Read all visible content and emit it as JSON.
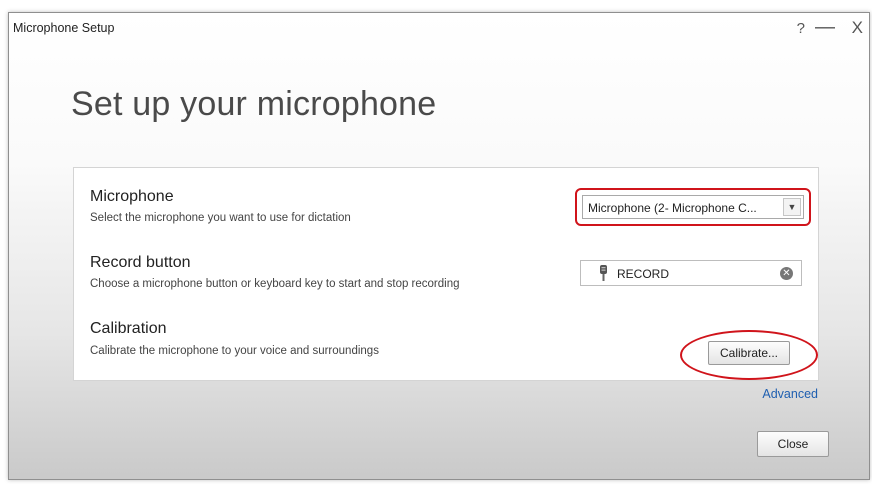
{
  "window": {
    "title": "Microphone Setup",
    "help": "?",
    "minimize": "—",
    "close": "X"
  },
  "heading": "Set up your microphone",
  "microphone": {
    "label": "Microphone",
    "description": "Select the microphone you want to use for dictation",
    "selected": "Microphone (2- Microphone C...",
    "arrow": "▼"
  },
  "record": {
    "label": "Record button",
    "description": "Choose a microphone button or keyboard key to start and stop recording",
    "key": "RECORD",
    "clear": "✕"
  },
  "calibration": {
    "label": "Calibration",
    "description": "Calibrate the microphone to your voice and surroundings",
    "button": "Calibrate..."
  },
  "advanced": "Advanced",
  "close_button": "Close",
  "colors": {
    "highlight": "#d0141b",
    "link": "#1f5fb0"
  }
}
